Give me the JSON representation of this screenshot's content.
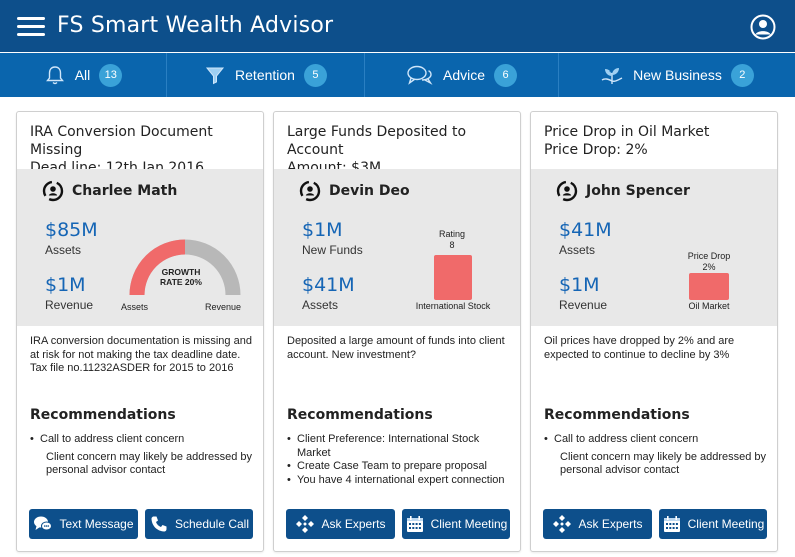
{
  "app": {
    "title": "FS Smart Wealth Advisor"
  },
  "tabs": [
    {
      "label": "All",
      "count": "13",
      "icon": "bell-icon"
    },
    {
      "label": "Retention",
      "count": "5",
      "icon": "funnel-icon"
    },
    {
      "label": "Advice",
      "count": "6",
      "icon": "chat-bubbles-icon"
    },
    {
      "label": "New Business",
      "count": "2",
      "icon": "money-plant-icon"
    }
  ],
  "cards": [
    {
      "title_line1": "IRA Conversion Document Missing",
      "title_line2": "Dead line: 12th Jan 2016",
      "client": "Charlee Math",
      "metric1_value": "$85M",
      "metric1_label": "Assets",
      "metric2_value": "$1M",
      "metric2_label": "Revenue",
      "gauge": {
        "text_line1": "GROWTH",
        "text_line2": "RATE 20%",
        "left_label": "Assets",
        "right_label": "Revenue",
        "fill_fraction": 0.5
      },
      "description": "IRA conversion documentation is missing and at risk for not making the tax deadline date. Tax file no.11232ASDER for 2015 to 2016",
      "rec_title": "Recommendations",
      "recs": [
        {
          "text": "Call to address client concern",
          "bullet": true
        },
        {
          "text": "Client concern may likely be addressed by personal advisor contact",
          "bullet": false
        }
      ],
      "buttons": [
        "Text Message",
        "Schedule Call"
      ]
    },
    {
      "title_line1": "Large Funds Deposited to Account",
      "title_line2": "Amount: $3M",
      "client": "Devin Deo",
      "metric1_value": "$1M",
      "metric1_label": "New Funds",
      "metric2_value": "$41M",
      "metric2_label": "Assets",
      "bar": {
        "top_label": "Rating",
        "top_value": "8",
        "bottom_label": "International Stock",
        "value": 8
      },
      "description": "Deposited a large amount of funds into client account. New investment?",
      "rec_title": "Recommendations",
      "recs": [
        {
          "text": "Client Preference: International Stock Market",
          "bullet": true
        },
        {
          "text": "Create Case Team to prepare proposal",
          "bullet": true
        },
        {
          "text": "You have 4 international expert connection",
          "bullet": true
        }
      ],
      "buttons": [
        "Ask Experts",
        "Client Meeting"
      ]
    },
    {
      "title_line1": "Price Drop in Oil Market",
      "title_line2": "Price Drop: 2%",
      "client": "John Spencer",
      "metric1_value": "$41M",
      "metric1_label": "Assets",
      "metric2_value": "$1M",
      "metric2_label": "Revenue",
      "bar": {
        "top_label": "Price Drop",
        "top_value": "2%",
        "bottom_label": "Oil Market",
        "value": 2
      },
      "description": "Oil prices have dropped by 2% and are expected to continue to decline by 3%",
      "rec_title": "Recommendations",
      "recs": [
        {
          "text": "Call to address client concern",
          "bullet": true
        },
        {
          "text": "Client concern may likely be addressed by personal advisor contact",
          "bullet": false
        }
      ],
      "buttons": [
        "Ask Experts",
        "Client Meeting"
      ]
    }
  ],
  "colors": {
    "header": "#0d4f8b",
    "tabbar": "#0a65ad",
    "badge": "#3aa2d8",
    "accent_red": "#f06060",
    "value_blue": "#1565b5"
  }
}
